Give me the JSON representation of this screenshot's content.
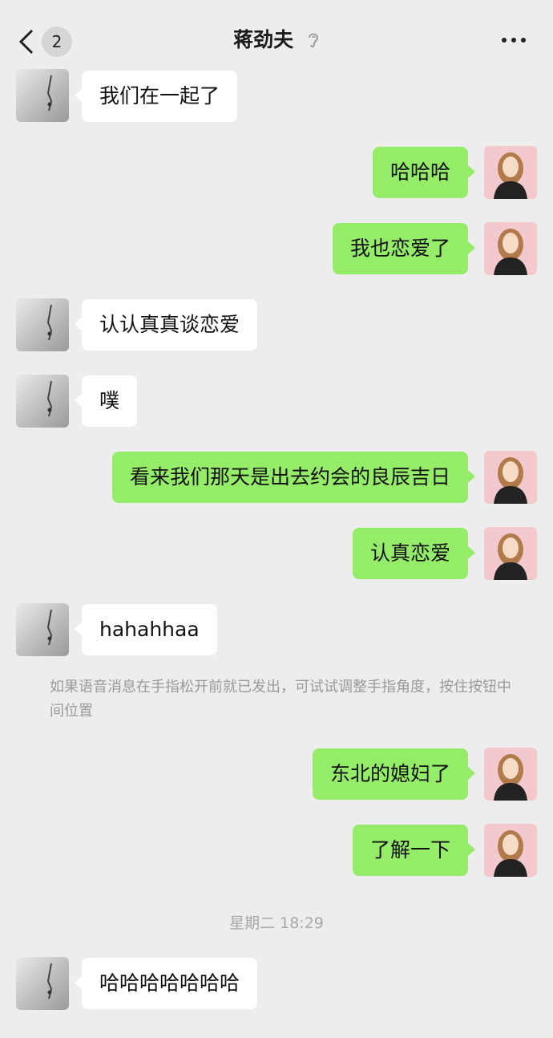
{
  "header": {
    "unread_count": "2",
    "title": "蒋劲夫"
  },
  "messages": [
    {
      "side": "left",
      "text": "我们在一起了"
    },
    {
      "side": "right",
      "text": "哈哈哈"
    },
    {
      "side": "right",
      "text": "我也恋爱了"
    },
    {
      "side": "left",
      "text": "认认真真谈恋爱"
    },
    {
      "side": "left",
      "text": "噗"
    },
    {
      "side": "right",
      "text": "看来我们那天是出去约会的良辰吉日"
    },
    {
      "side": "right",
      "text": "认真恋爱"
    },
    {
      "side": "left",
      "text": "hahahhaa"
    },
    {
      "side": "right",
      "text": "东北的媳妇了"
    },
    {
      "side": "right",
      "text": "了解一下"
    },
    {
      "side": "left",
      "text": "哈哈哈哈哈哈哈"
    }
  ],
  "system_hint": "如果语音消息在手指松开前就已发出，可试试调整手指角度，按住按钮中间位置",
  "timestamp": "星期二 18:29",
  "colors": {
    "background": "#ededed",
    "incoming_bubble": "#ffffff",
    "outgoing_bubble": "#95ec69",
    "hint_text": "#9a9a9a"
  },
  "icons": {
    "back": "chevron-left-icon",
    "title_suffix": "ear-icon",
    "more": "more-dots-icon"
  }
}
